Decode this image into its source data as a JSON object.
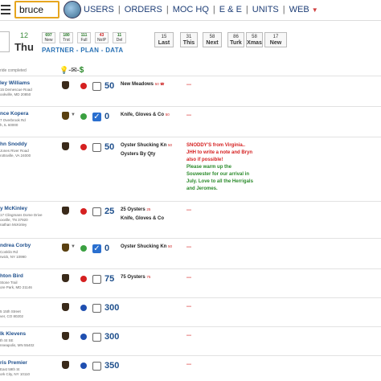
{
  "search": {
    "value": "bruce"
  },
  "nav": {
    "users": "USERS",
    "orders": "ORDERS",
    "moc_hq": "MOC HQ",
    "e_e": "E & E",
    "units": "UNITS",
    "web": "WEB"
  },
  "date": {
    "prev": "",
    "day_num": "12",
    "day_name": "Thu"
  },
  "chips": [
    {
      "n": "697",
      "l": "New"
    },
    {
      "n": "180",
      "l": "Trst"
    },
    {
      "n": "111",
      "l": "Full"
    },
    {
      "n": "43",
      "l": "NoIP"
    },
    {
      "n": "11",
      "l": "Del"
    }
  ],
  "subnav": {
    "partner": "PARTNER",
    "plan": "PLAN",
    "data": "DATA"
  },
  "navbtns": [
    {
      "n": "15",
      "l": "Last"
    },
    {
      "n": "31",
      "l": "This"
    },
    {
      "n": "58",
      "l": "Next"
    },
    {
      "n": "86",
      "l": "Turk"
    },
    {
      "n": "58",
      "l": "Xmas"
    },
    {
      "n": "17",
      "l": "New"
    }
  ],
  "done_text": "ride completed",
  "rows": [
    {
      "name": "ley Williams",
      "addr": [
        "15 Demescue Road",
        "ookville, MD 20850"
      ],
      "dot": "red",
      "checked": false,
      "qty": "50",
      "products": [
        "New Meadows"
      ],
      "tag": "50 ☎",
      "note": [],
      "dash": "---"
    },
    {
      "name": "nce Kopera",
      "addr": [
        "7 Overbrook Rd",
        "h, IL 60000"
      ],
      "dot": "green",
      "checked": true,
      "qty": "0",
      "products": [
        "Knife, Gloves & Co"
      ],
      "tag": "50",
      "note": [],
      "dash": "---"
    },
    {
      "name": "hn Snoddy",
      "addr": [
        "Jones River Road",
        "rottsville, VA 24000"
      ],
      "dot": "red",
      "checked": false,
      "qty": "50",
      "products": [
        "Oyster Shucking Kn",
        "Oysters By Qty"
      ],
      "tag": "50",
      "note": [
        {
          "c": "r",
          "t": "SNODDY'S from Virginia.."
        },
        {
          "c": "r",
          "t": "JHH to write a note and Bryn"
        },
        {
          "c": "r",
          "t": "also if possible!"
        },
        {
          "c": "g",
          "t": "Please warm up the"
        },
        {
          "c": "g",
          "t": "Souwester for our arrival in"
        },
        {
          "c": "g",
          "t": "July. Love to all the Herrigals"
        },
        {
          "c": "g",
          "t": "and Jeromes."
        }
      ],
      "dash": ""
    },
    {
      "name": "y McKinley",
      "addr": [
        "17 Clingmans Dome Drive",
        "oxville, TN 37920",
        "nathan McKinley"
      ],
      "dot": "red",
      "checked": false,
      "qty": "25",
      "products": [
        "25 Oysters",
        "Knife, Gloves & Co"
      ],
      "tag": "25",
      "note": [],
      "dash": "---"
    },
    {
      "name": "ndrea Corby",
      "addr": [
        "Conklin Rd",
        "rwick, NY 10990"
      ],
      "dot": "green",
      "checked": true,
      "qty": "0",
      "products": [
        "Oyster Shucking Kn"
      ],
      "tag": "50",
      "note": [],
      "dash": "---"
    },
    {
      "name": "hton Bird",
      "addr": [
        "Stone Trail",
        "ore Park, MD 21146"
      ],
      "dot": "red",
      "checked": false,
      "qty": "75",
      "products": [
        "75 Oysters"
      ],
      "tag": "75",
      "note": [],
      "dash": "---"
    },
    {
      "name": "",
      "addr": [
        "5 15th Street",
        "ver, CO 80202"
      ],
      "dot": "blue",
      "checked": false,
      "qty": "300",
      "products": [],
      "tag": "",
      "note": [],
      "dash": "---"
    },
    {
      "name": "lk Klevens",
      "addr": [
        "th St SE",
        "nneapolis, MN 55402"
      ],
      "dot": "blue",
      "checked": false,
      "qty": "300",
      "products": [],
      "tag": "",
      "note": [],
      "dash": "---"
    },
    {
      "name": "ris Premier",
      "addr": [
        "East 59th St",
        "ork City, NY 10110"
      ],
      "dot": "blue",
      "checked": false,
      "qty": "350",
      "products": [],
      "tag": "",
      "note": [],
      "dash": "---"
    }
  ]
}
